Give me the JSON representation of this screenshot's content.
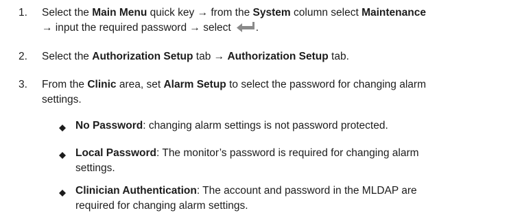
{
  "steps": [
    {
      "number": "1.",
      "line1": {
        "t1": "Select the ",
        "b1": "Main Menu",
        "t2": " quick key → from the ",
        "b2": "System",
        "t3": " column select ",
        "b3": "Maintenance"
      },
      "line2": {
        "t1": "→ input the required password → select",
        "t2": "."
      }
    },
    {
      "number": "2.",
      "t1": "Select the ",
      "b1": "Authorization Setup",
      "t2": " tab → ",
      "b2": "Authorization Setup",
      "t3": " tab."
    },
    {
      "number": "3.",
      "t1": "From the ",
      "b1": "Clinic",
      "t2": " area, set ",
      "b2": "Alarm Setup",
      "t3": " to select the password for changing alarm",
      "t4": "settings."
    }
  ],
  "bullets": [
    {
      "term": "No Password",
      "text": ": changing alarm settings is not password protected.",
      "text2": ""
    },
    {
      "term": "Local Password",
      "text": ": The monitor’s password is required for changing alarm",
      "text2": "settings."
    },
    {
      "term": "Clinician Authentication",
      "text": ": The account and password in the MLDAP are",
      "text2": "required for changing alarm settings."
    }
  ],
  "icons": {
    "enter": "enter-arrow-icon",
    "bullet": "diamond-bullet-icon"
  }
}
